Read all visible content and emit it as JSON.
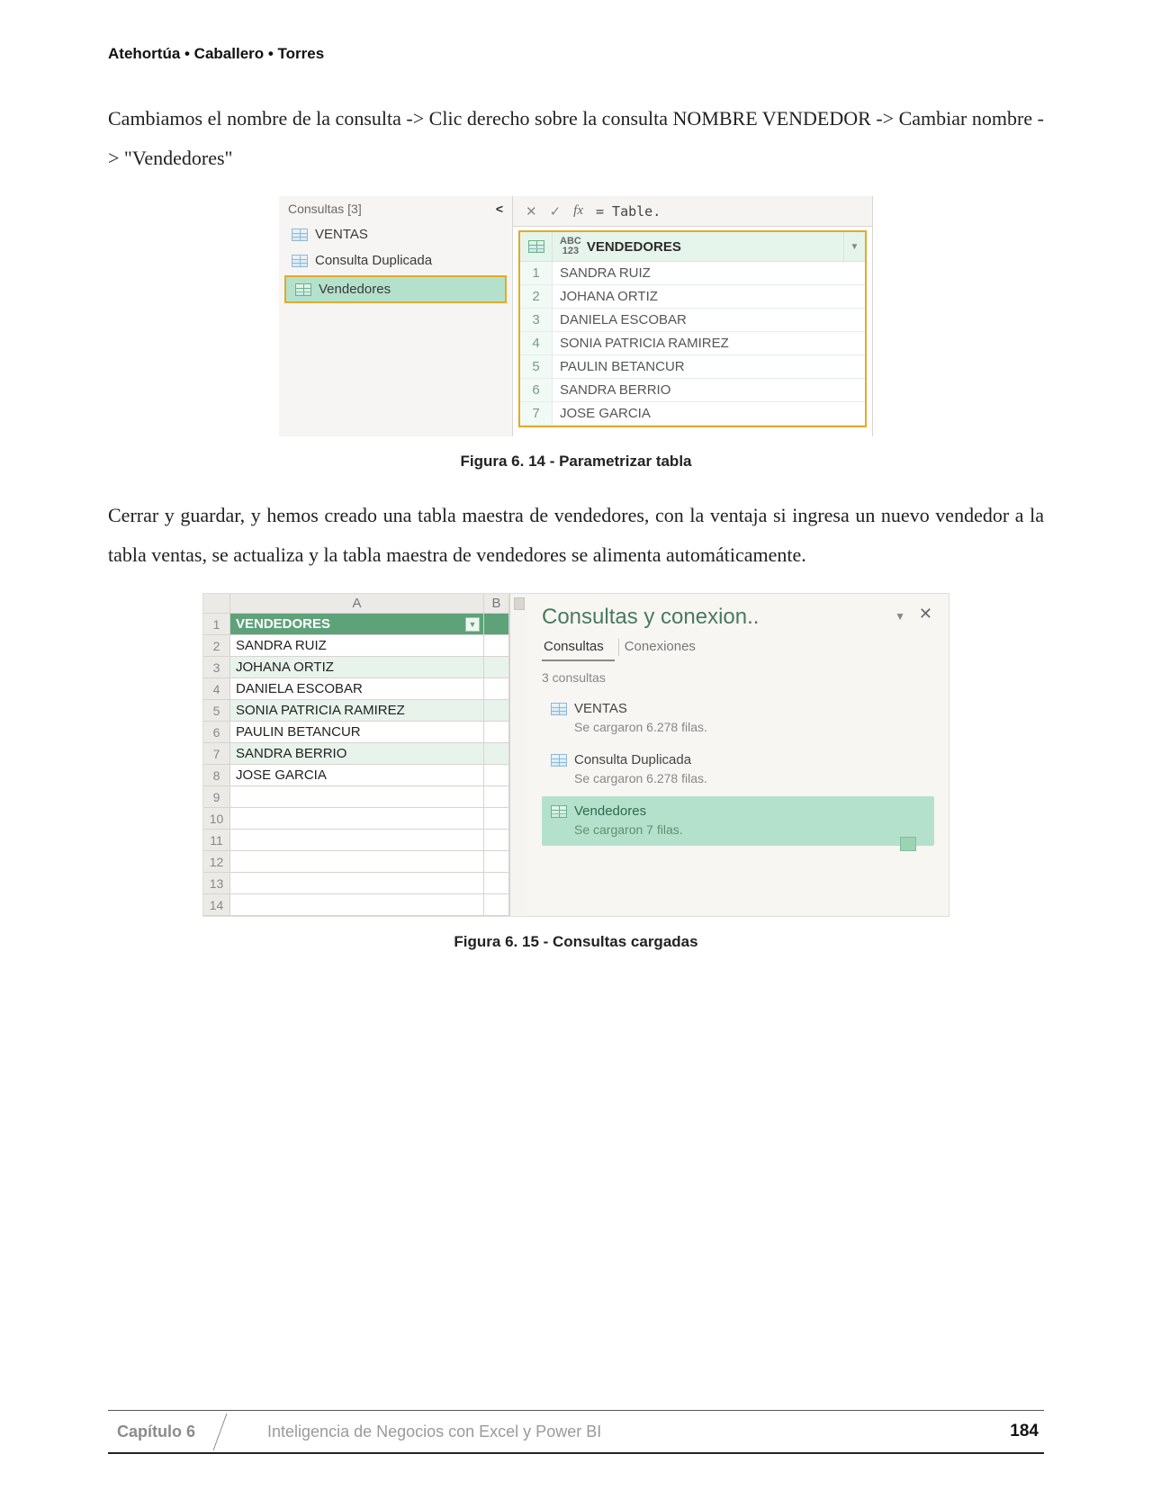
{
  "authors": "Atehortúa • Caballero • Torres",
  "para1": "Cambiamos el nombre de la consulta -> Clic derecho sobre la consulta NOMBRE VENDEDOR -> Cambiar nombre -> \"Vendedores\"",
  "fig1": {
    "queries_title": "Consultas [3]",
    "queries": [
      "VENTAS",
      "Consulta Duplicada",
      "Vendedores"
    ],
    "selected_index": 2,
    "formula_x": "✕",
    "formula_check": "✓",
    "formula_fx": "fx",
    "formula_text": "= Table.",
    "col_type": "ABC\n123",
    "col_name": "VENDEDORES",
    "rows": [
      "SANDRA RUIZ",
      "JOHANA ORTIZ",
      "DANIELA ESCOBAR",
      "SONIA PATRICIA RAMIREZ",
      "PAULIN BETANCUR",
      "SANDRA BERRIO",
      "JOSE GARCIA"
    ]
  },
  "caption1": "Figura 6. 14 - Parametrizar tabla",
  "para2": "Cerrar y guardar, y hemos creado una tabla maestra de vendedores, con la ventaja si ingresa un nuevo vendedor a la tabla ventas, se actualiza y la tabla maestra de vendedores se alimenta automáticamente.",
  "fig2": {
    "colA": "A",
    "colB": "B",
    "header_cell": "VENDEDORES",
    "rows": [
      "SANDRA RUIZ",
      "JOHANA ORTIZ",
      "DANIELA ESCOBAR",
      "SONIA PATRICIA RAMIREZ",
      "PAULIN BETANCUR",
      "SANDRA BERRIO",
      "JOSE GARCIA"
    ],
    "extra_rows": 6,
    "pane_title": "Consultas y conexion..",
    "tab_consultas": "Consultas",
    "tab_conexiones": "Conexiones",
    "count_label": "3 consultas",
    "entries": [
      {
        "name": "VENTAS",
        "status": "Se cargaron 6.278 filas."
      },
      {
        "name": "Consulta Duplicada",
        "status": "Se cargaron 6.278 filas."
      },
      {
        "name": "Vendedores",
        "status": "Se cargaron 7 filas."
      }
    ],
    "selected_index": 2
  },
  "caption2": "Figura 6. 15 - Consultas cargadas",
  "footer": {
    "chapter": "Capítulo 6",
    "title": "Inteligencia de Negocios con Excel y Power BI",
    "page": "184"
  }
}
